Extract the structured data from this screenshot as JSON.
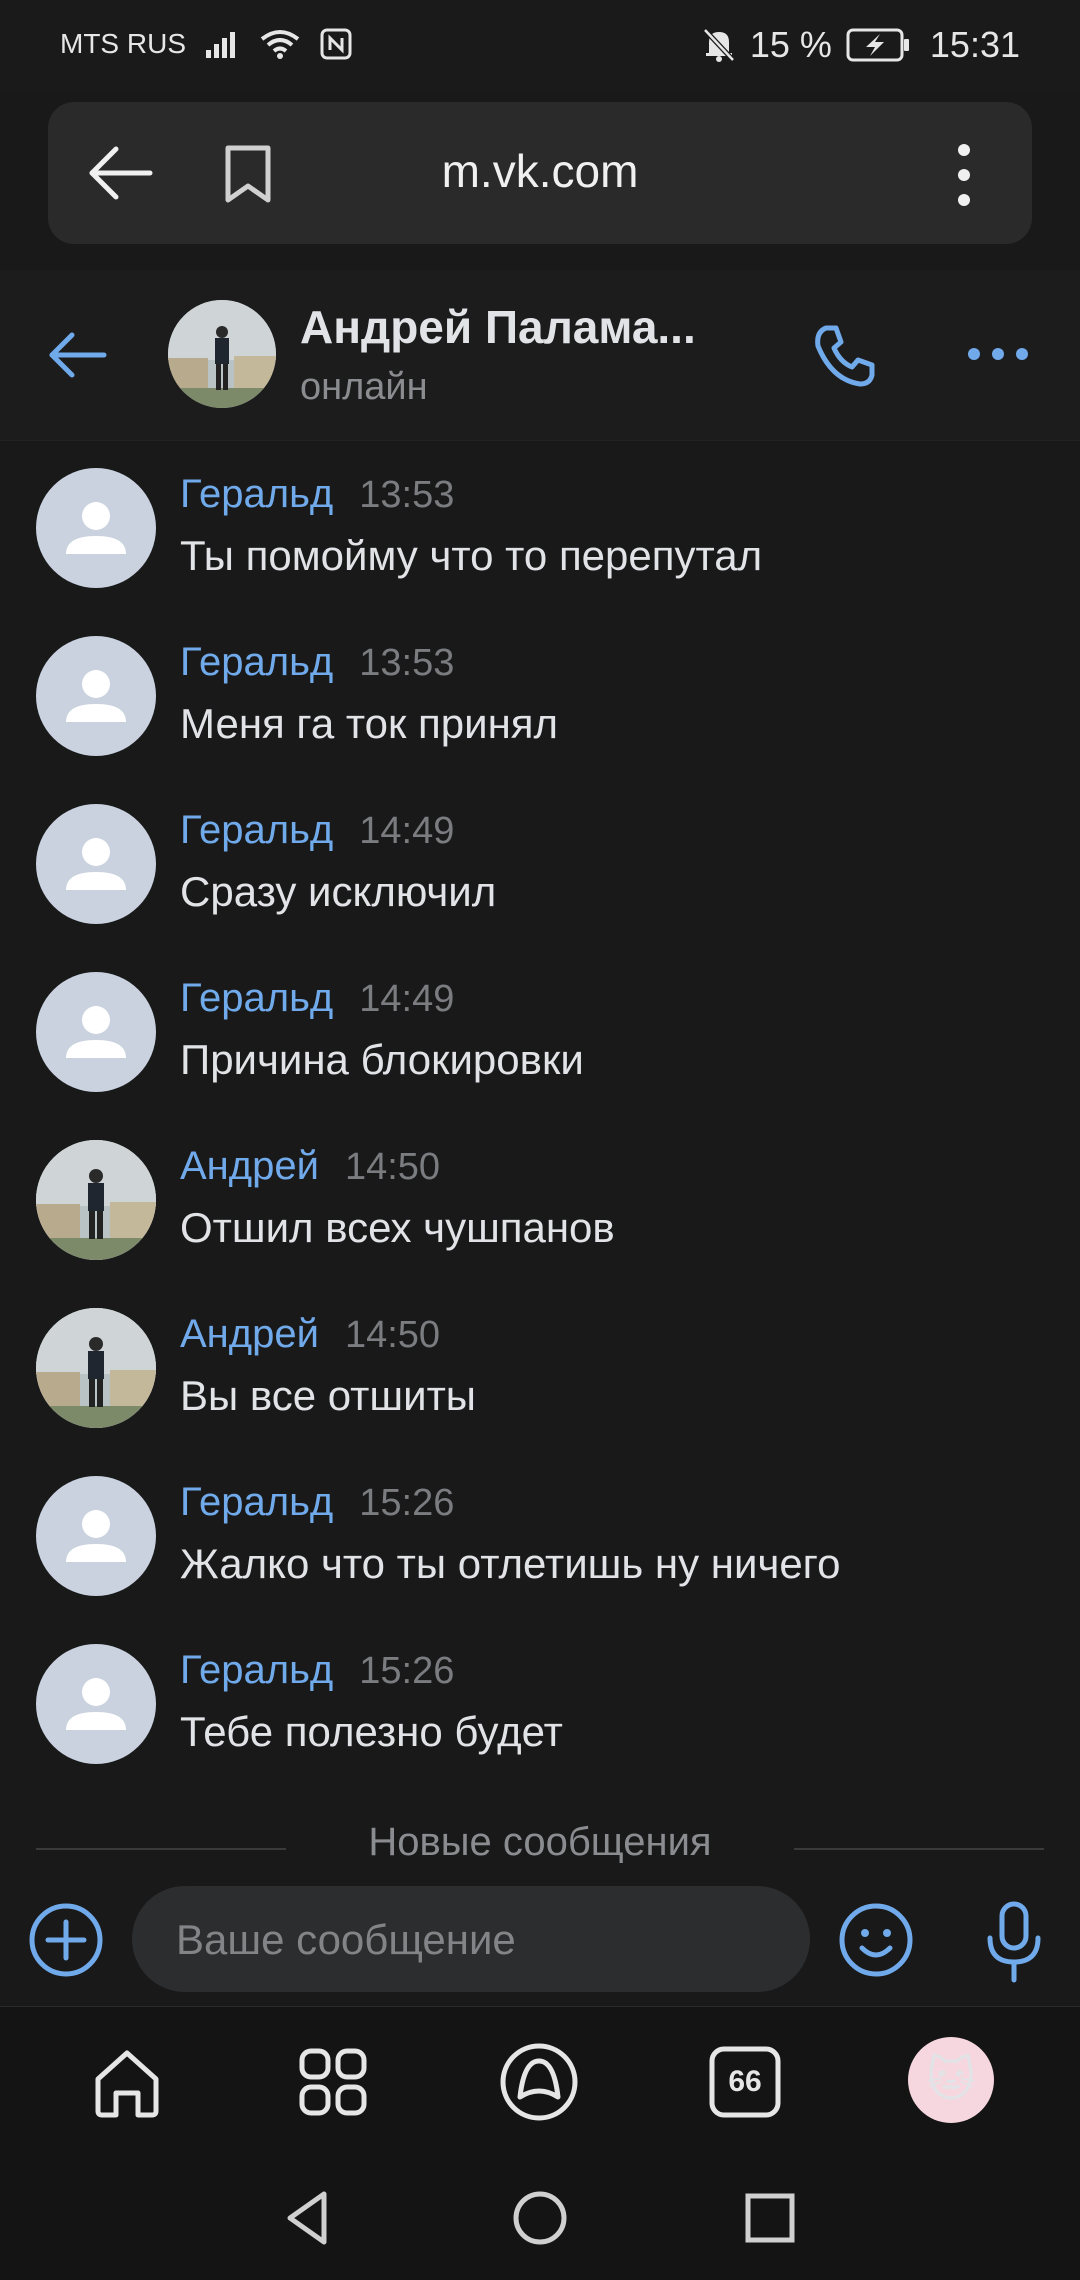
{
  "status_bar": {
    "carrier": "MTS RUS",
    "battery_pct": "15 %",
    "time": "15:31"
  },
  "browser": {
    "url": "m.vk.com"
  },
  "chat_header": {
    "name": "Андрей Палама...",
    "status": "онлайн"
  },
  "messages": [
    {
      "author": "Геральд",
      "time": "13:53",
      "text": "Ты помойму что то перепутал",
      "avatar": "default-user"
    },
    {
      "author": "Геральд",
      "time": "13:53",
      "text": "Меня га ток принял",
      "avatar": "default-user"
    },
    {
      "author": "Геральд",
      "time": "14:49",
      "text": "Сразу исключил",
      "avatar": "default-user"
    },
    {
      "author": "Геральд",
      "time": "14:49",
      "text": "Причина блокировки",
      "avatar": "default-user"
    },
    {
      "author": "Андрей",
      "time": "14:50",
      "text": "Отшил всех чушпанов",
      "avatar": "photo"
    },
    {
      "author": "Андрей",
      "time": "14:50",
      "text": "Вы все отшиты",
      "avatar": "photo"
    },
    {
      "author": "Геральд",
      "time": "15:26",
      "text": "Жалко что ты отлетишь ну ничего",
      "avatar": "default-user"
    },
    {
      "author": "Геральд",
      "time": "15:26",
      "text": "Тебе полезно будет",
      "avatar": "default-user"
    }
  ],
  "divider_label": "Новые сообщения",
  "composer": {
    "placeholder": "Ваше сообщение"
  },
  "app_nav": {
    "tabs_badge": "66",
    "items": [
      "home-icon",
      "apps-grid-icon",
      "alice-icon",
      "tabs-icon",
      "profile-avatar"
    ]
  },
  "colors": {
    "accent": "#71aaeb",
    "background": "#19191a",
    "text": "#e1e3e6",
    "secondary": "#8a8c90"
  }
}
